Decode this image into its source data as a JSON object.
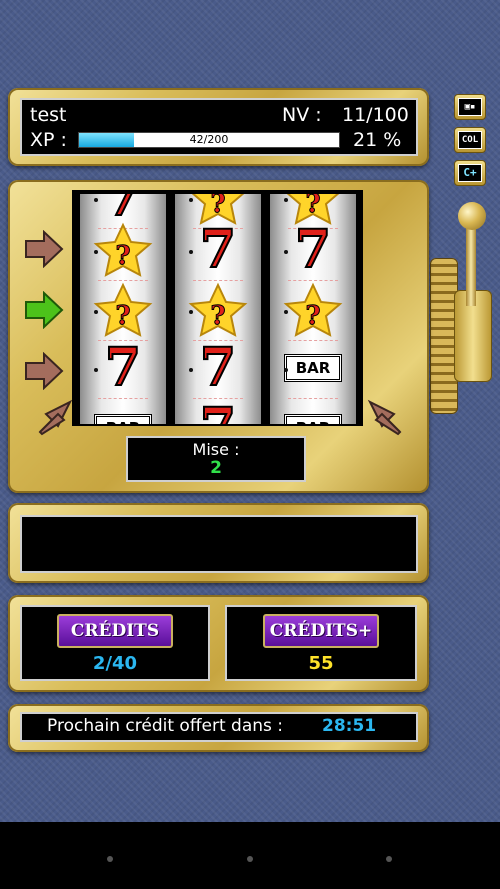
{
  "player": {
    "name": "test",
    "level_label": "NV :",
    "level": "11/100",
    "xp_label": "XP :",
    "xp_text": "42/200",
    "xp_percent": "21 %",
    "xp_fraction": 0.21
  },
  "side_buttons": [
    {
      "label": "ꟷ"
    },
    {
      "label": "COL"
    },
    {
      "label": "C+"
    }
  ],
  "reels": [
    [
      "seven",
      "star",
      "star",
      "seven",
      "bar"
    ],
    [
      "star",
      "seven",
      "star",
      "seven",
      "seven"
    ],
    [
      "star",
      "seven",
      "star",
      "bar",
      "bar"
    ]
  ],
  "symbols": {
    "seven": "7",
    "bar": "BAR",
    "star": "?"
  },
  "bet": {
    "label": "Mise :",
    "value": "2"
  },
  "credits": {
    "button_label": "CRÉDITS",
    "value": "2/40",
    "plus_button_label": "CRÉDITS+",
    "plus_value": "55"
  },
  "next_credit": {
    "label": "Prochain crédit offert dans :",
    "time": "28:51"
  },
  "colors": {
    "accent_blue": "#2bb7f0",
    "green": "#31e04a",
    "yellow": "#ffe32a",
    "purple": "#7a25c0"
  }
}
